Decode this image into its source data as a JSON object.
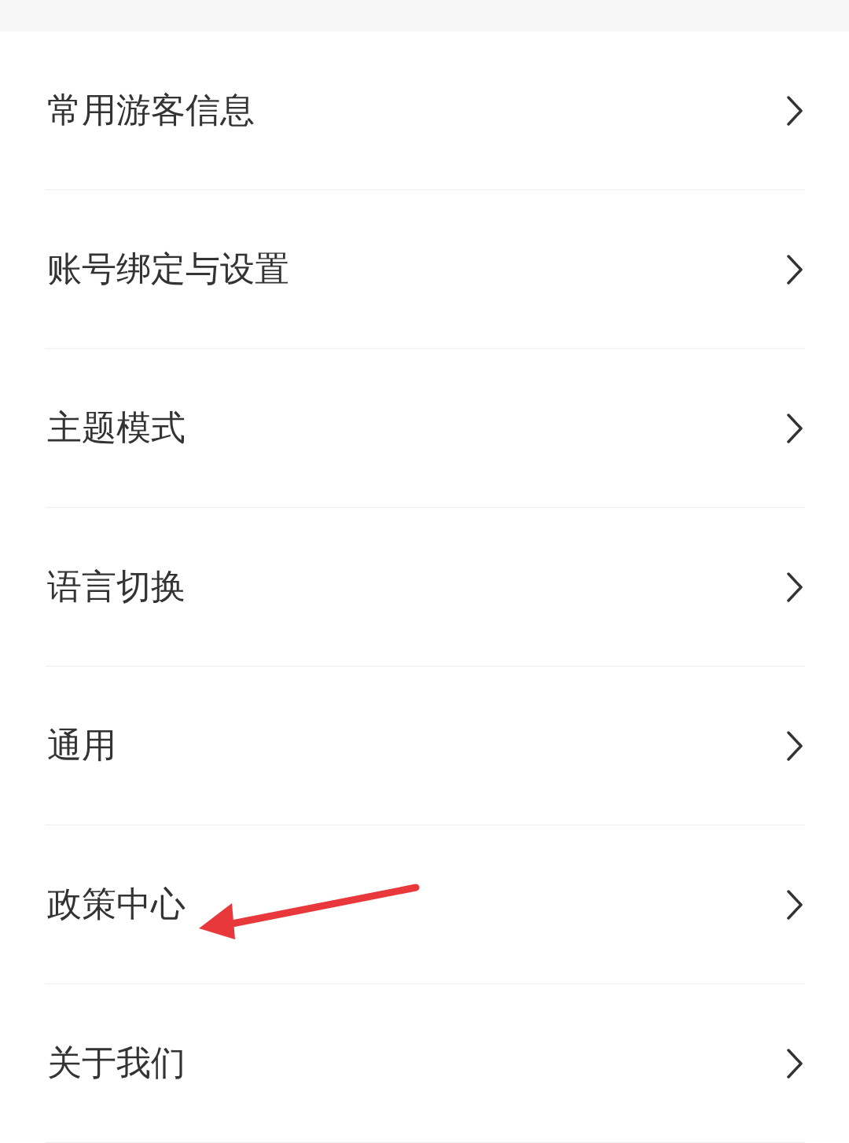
{
  "items": [
    {
      "label": "常用游客信息"
    },
    {
      "label": "账号绑定与设置"
    },
    {
      "label": "主题模式"
    },
    {
      "label": "语言切换"
    },
    {
      "label": "通用"
    },
    {
      "label": "政策中心"
    },
    {
      "label": "关于我们"
    }
  ]
}
